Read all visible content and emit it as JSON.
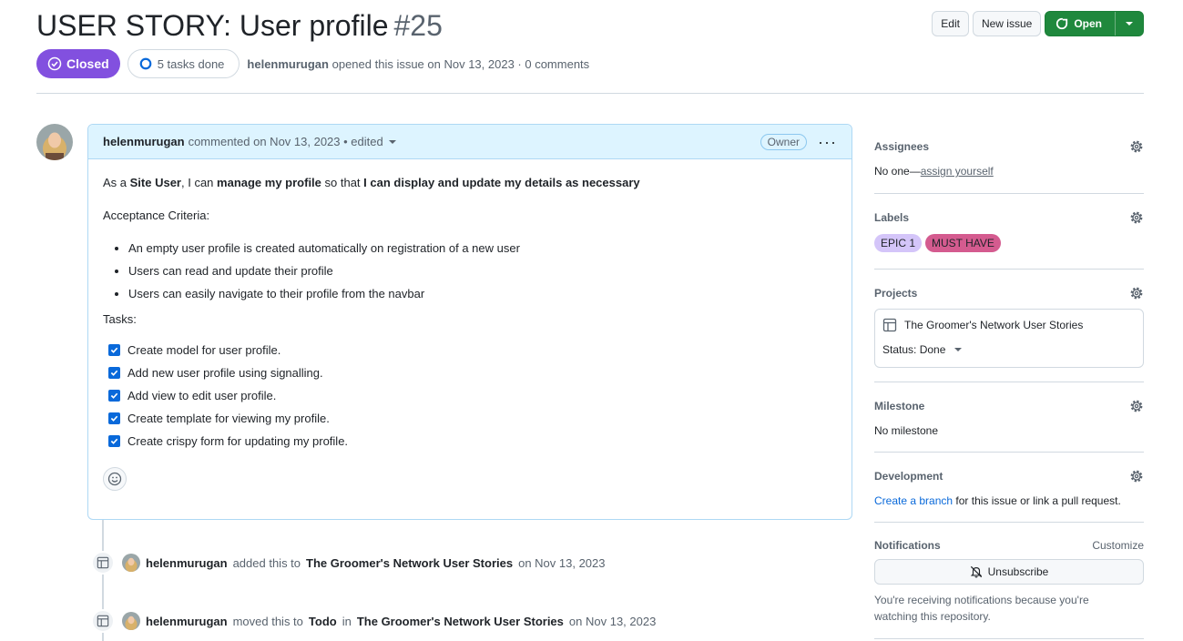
{
  "issue": {
    "title": "USER STORY: User profile",
    "number": "#25",
    "state": "Closed",
    "tasks_summary": "5 tasks done",
    "author": "helenmurugan",
    "opened_text": "opened this issue on Nov 13, 2023 · 0 comments"
  },
  "header_buttons": {
    "edit": "Edit",
    "new_issue": "New issue",
    "open": "Open"
  },
  "comment": {
    "author": "helenmurugan",
    "meta": "commented on Nov 13, 2023 • edited",
    "role_badge": "Owner",
    "story": {
      "p1": "As a ",
      "role": "Site User",
      "p2": ", I can ",
      "action": "manage my profile",
      "p3": " so that ",
      "goal": "I can display and update my details as necessary"
    },
    "criteria_heading": "Acceptance Criteria:",
    "criteria": [
      "An empty user profile is created automatically on registration of a new user",
      "Users can read and update their profile",
      "Users can easily navigate to their profile from the navbar"
    ],
    "tasks_heading": "Tasks:",
    "tasks": [
      "Create model for user profile.",
      "Add new user profile using signalling.",
      "Add view to edit user profile.",
      "Create template for viewing my profile.",
      "Create crispy form for updating my profile."
    ]
  },
  "timeline": [
    {
      "actor": "helenmurugan",
      "text1": "added this to",
      "project": "The Groomer's Network User Stories",
      "date": "on Nov 13, 2023"
    },
    {
      "actor": "helenmurugan",
      "text1": "moved this to",
      "column": "Todo",
      "text2": "in",
      "project": "The Groomer's Network User Stories",
      "date": "on Nov 13, 2023"
    }
  ],
  "sidebar": {
    "assignees": {
      "title": "Assignees",
      "none": "No one—",
      "link": "assign yourself"
    },
    "labels": {
      "title": "Labels",
      "items": [
        {
          "name": "EPIC 1",
          "bg": "#d4c5f9",
          "fg": "#1f2328"
        },
        {
          "name": "MUST HAVE",
          "bg": "#d45b8f",
          "fg": "#1f2328"
        }
      ]
    },
    "projects": {
      "title": "Projects",
      "name": "The Groomer's Network User Stories",
      "status": "Status: Done"
    },
    "milestone": {
      "title": "Milestone",
      "value": "No milestone"
    },
    "development": {
      "title": "Development",
      "link": "Create a branch",
      "rest": " for this issue or link a pull request."
    },
    "notifications": {
      "title": "Notifications",
      "customize": "Customize",
      "button": "Unsubscribe",
      "note": "You're receiving notifications because you're watching this repository."
    }
  },
  "colors": {
    "closed_purple": "#8250df",
    "open_green": "#1f883d",
    "link_blue": "#0969da"
  },
  "icons": [
    "check-circle-icon",
    "progress-circle-icon",
    "chevron-down-icon",
    "kebab-icon",
    "checkbox-icon",
    "smiley-icon",
    "table-icon",
    "gear-icon",
    "bell-slash-icon"
  ]
}
